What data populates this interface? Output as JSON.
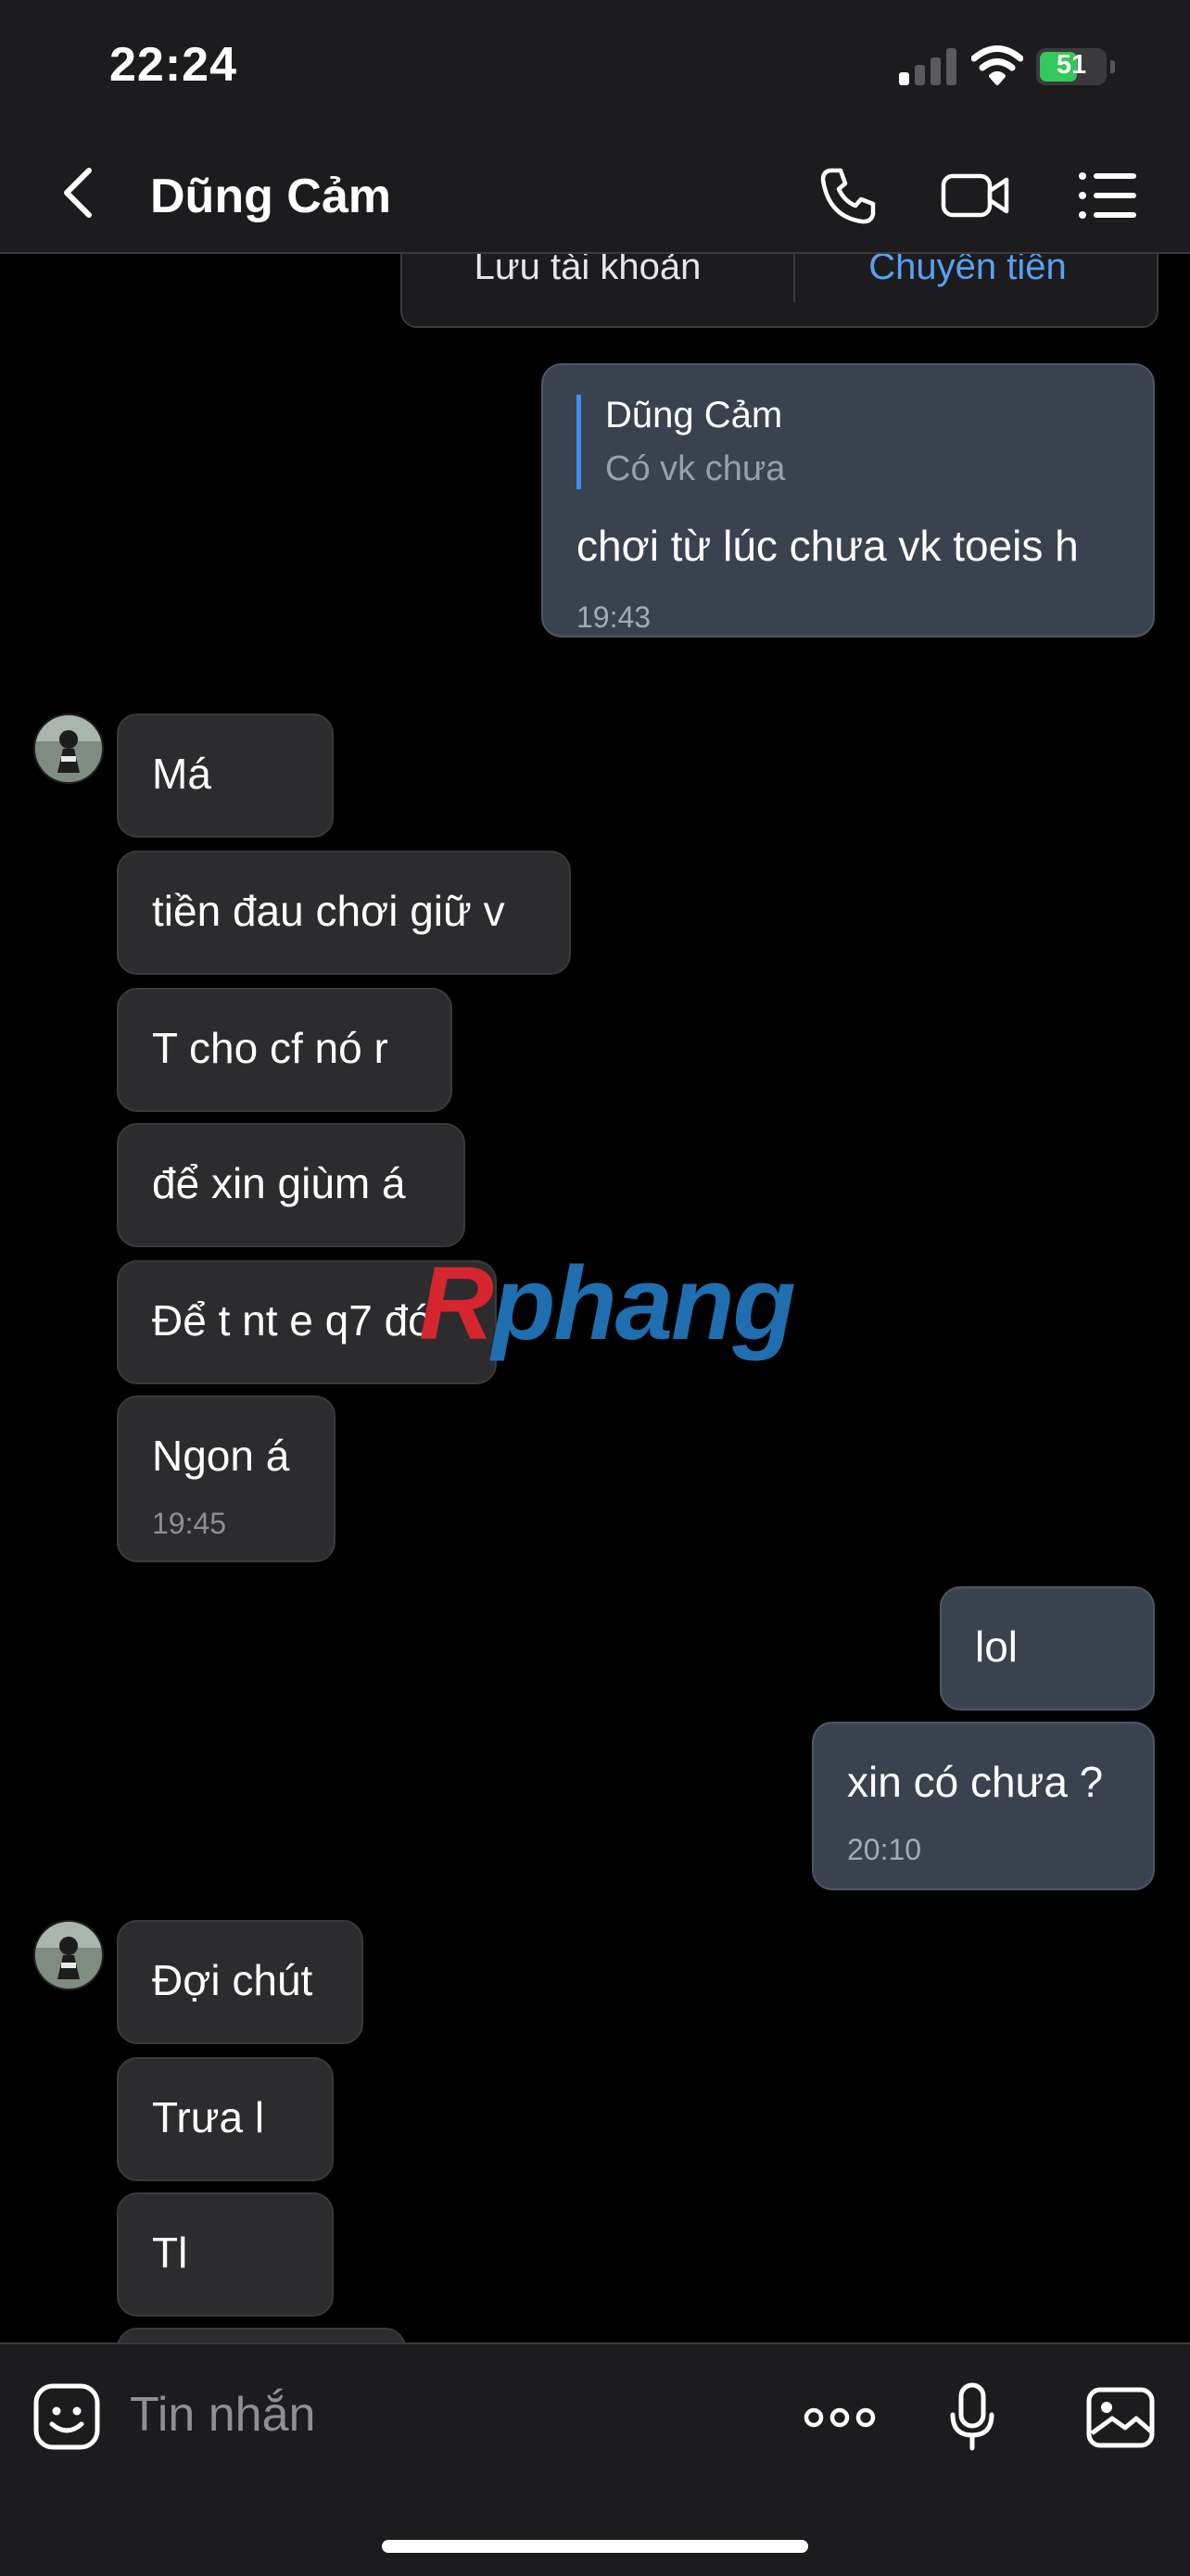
{
  "status": {
    "time": "22:24",
    "battery": "51",
    "battery_level": 0.51
  },
  "header": {
    "title": "Dũng Cảm",
    "icons": [
      "chevron-left-icon",
      "phone-icon",
      "video-icon",
      "list-icon"
    ]
  },
  "card": {
    "left_action": "Lưu tài khoản",
    "right_action": "Chuyển tiền"
  },
  "messages": [
    {
      "dir": "out",
      "quote_name": "Dũng Cảm",
      "quote_text": "Có vk chưa",
      "text": "chơi từ lúc chưa vk toeis h",
      "time": "19:43"
    },
    {
      "dir": "in",
      "text": "Má"
    },
    {
      "dir": "in",
      "text": "tiền đau chơi giữ v"
    },
    {
      "dir": "in",
      "text": "T cho cf nó r"
    },
    {
      "dir": "in",
      "text": "để xin giùm á"
    },
    {
      "dir": "in",
      "text": "Để t nt e q7 đó"
    },
    {
      "dir": "in",
      "text": "Ngon á",
      "time": "19:45"
    },
    {
      "dir": "out",
      "text": "lol"
    },
    {
      "dir": "out",
      "text": "xin có chưa ?",
      "time": "20:10"
    },
    {
      "dir": "in",
      "text": "Đợi chút"
    },
    {
      "dir": "in",
      "text": "Trưa l"
    },
    {
      "dir": "in",
      "text": "Tl"
    }
  ],
  "watermark": {
    "first": "R",
    "rest": "phang"
  },
  "composer": {
    "placeholder": "Tin nhắn",
    "icons": [
      "emoji-icon",
      "more-icon",
      "microphone-icon",
      "image-icon"
    ]
  },
  "colors": {
    "background": "#000000",
    "incoming_bubble": "#2c2c2e",
    "outgoing_bubble": "#3a4250",
    "accent": "#3d8ef5",
    "link": "#5aa0f2"
  }
}
